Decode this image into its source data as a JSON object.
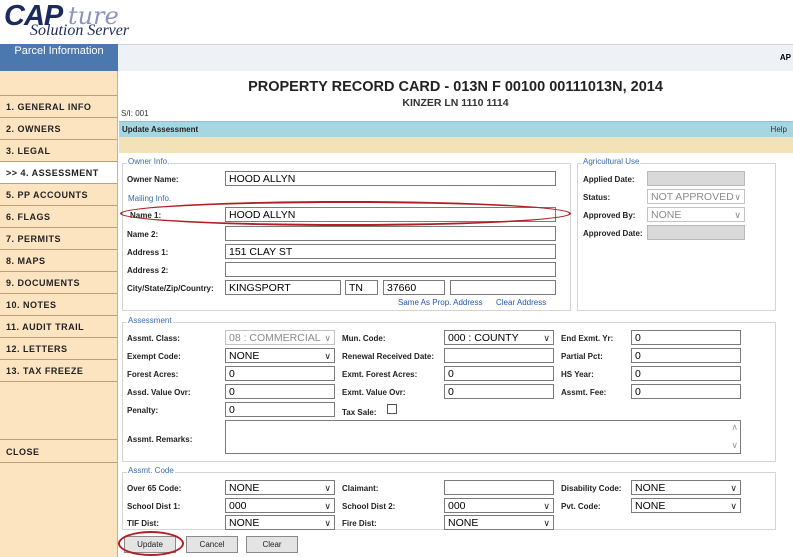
{
  "app": {
    "logo_main": "CAP",
    "logo_script": "ture",
    "logo_sub": "Solution Server",
    "parcel_tab": "Parcel Information",
    "top_right": "AP"
  },
  "sidebar": {
    "items": [
      {
        "label": "1. GENERAL INFO"
      },
      {
        "label": "2. OWNERS"
      },
      {
        "label": "3. LEGAL"
      },
      {
        "label": ">> 4. ASSESSMENT"
      },
      {
        "label": "5. PP ACCOUNTS"
      },
      {
        "label": "6. FLAGS"
      },
      {
        "label": "7. PERMITS"
      },
      {
        "label": "8. MAPS"
      },
      {
        "label": "9. DOCUMENTS"
      },
      {
        "label": "10. NOTES"
      },
      {
        "label": "11. AUDIT TRAIL"
      },
      {
        "label": "12. LETTERS"
      },
      {
        "label": "13. TAX FREEZE"
      }
    ],
    "close": "CLOSE"
  },
  "card": {
    "title": "PROPERTY RECORD CARD - 013N F 00100 00111013N, 2014",
    "address": "KINZER LN 1110 1114",
    "sit": "S/I: 001",
    "section_title": "Update Assessment",
    "help": "Help"
  },
  "owner": {
    "legend": "Owner Info.",
    "owner_name_label": "Owner Name:",
    "owner_name": "HOOD ALLYN"
  },
  "mailing": {
    "legend": "Mailing Info.",
    "name1_label": "Name 1:",
    "name1": "HOOD ALLYN",
    "name2_label": "Name 2:",
    "name2": "",
    "address1_label": "Address 1:",
    "address1": "151 CLAY ST",
    "address2_label": "Address 2:",
    "address2": "",
    "csz_label": "City/State/Zip/Country:",
    "city": "KINGSPORT",
    "state": "TN",
    "zip": "37660",
    "country": "",
    "same_as_link": "Same As Prop. Address",
    "clear_link": "Clear Address"
  },
  "agri": {
    "legend": "Agricultural Use",
    "applied_label": "Applied Date:",
    "applied": "",
    "status_label": "Status:",
    "status": "NOT APPROVED",
    "approved_by_label": "Approved By:",
    "approved_by": "NONE",
    "approved_date_label": "Approved Date:",
    "approved_date": ""
  },
  "assessment": {
    "legend": "Assessment",
    "class_label": "Assmt. Class:",
    "class": "08 : COMMERCIAL",
    "mun_label": "Mun. Code:",
    "mun": "000 : COUNTY",
    "end_exmt_label": "End Exmt. Yr:",
    "end_exmt": "0",
    "exempt_label": "Exempt Code:",
    "exempt": "NONE",
    "renewal_label": "Renewal Received Date:",
    "renewal": "",
    "partial_label": "Partial Pct:",
    "partial": "0",
    "forest_label": "Forest Acres:",
    "forest": "0",
    "exmt_forest_label": "Exmt. Forest Acres:",
    "exmt_forest": "0",
    "hs_year_label": "HS Year:",
    "hs_year": "0",
    "assd_ovr_label": "Assd. Value Ovr:",
    "assd_ovr": "0",
    "exmt_ovr_label": "Exmt. Value Ovr:",
    "exmt_ovr": "0",
    "fee_label": "Assmt. Fee:",
    "fee": "0",
    "penalty_label": "Penalty:",
    "penalty": "0",
    "tax_sale_label": "Tax Sale:",
    "remarks_label": "Assmt. Remarks:",
    "remarks": ""
  },
  "code": {
    "legend": "Assmt. Code",
    "over65_label": "Over 65 Code:",
    "over65": "NONE",
    "claimant_label": "Claimant:",
    "claimant": "",
    "disability_label": "Disability Code:",
    "disability": "NONE",
    "school1_label": "School Dist 1:",
    "school1": "000",
    "school2_label": "School Dist 2:",
    "school2": "000",
    "pvt_label": "Pvt. Code:",
    "pvt": "NONE",
    "tif_label": "TIF Dist:",
    "tif": "NONE",
    "fire_label": "Fire Dist:",
    "fire": "NONE"
  },
  "buttons": {
    "update": "Update",
    "cancel": "Cancel",
    "clear": "Clear"
  },
  "colors": {
    "sidebar_bg": "#fde4c0",
    "section_bar": "#a7d6e3",
    "highlight_oval": "#b01f24",
    "logo": "#1b2a5e"
  }
}
